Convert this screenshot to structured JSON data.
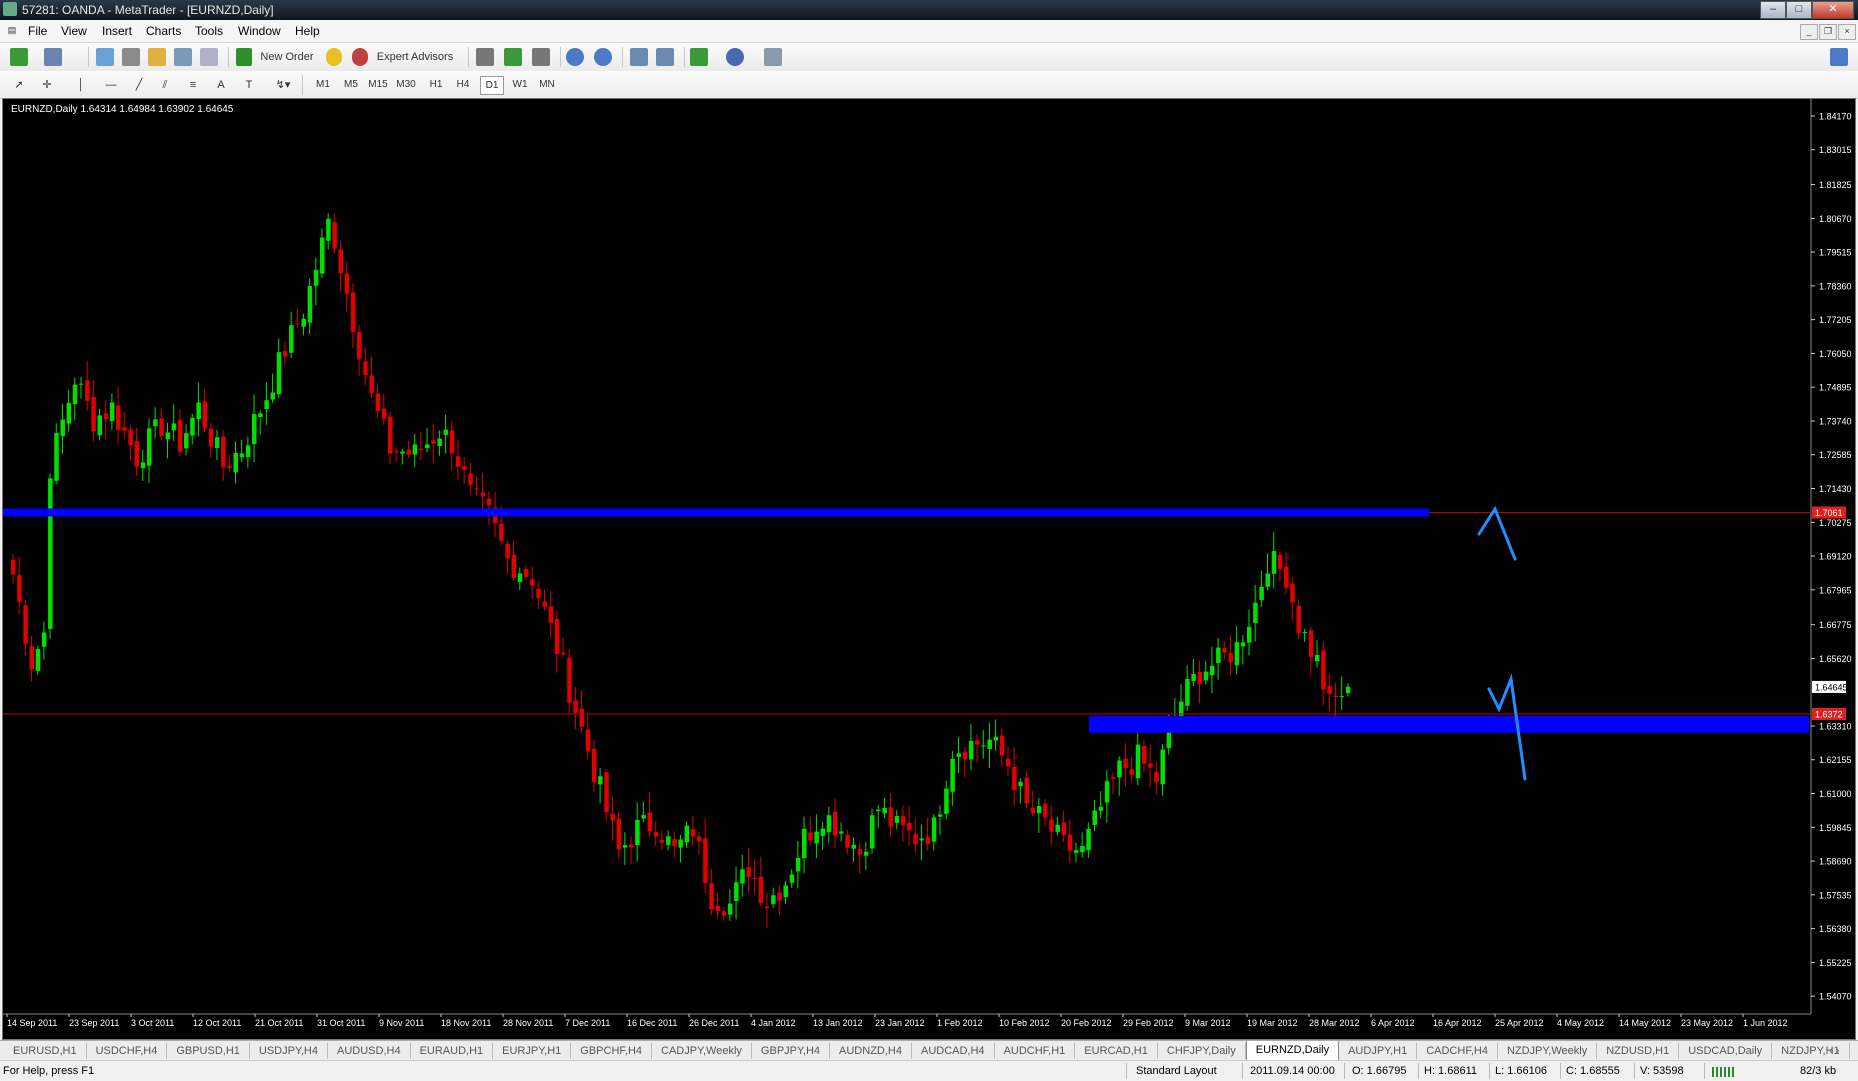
{
  "window": {
    "title": "57281: OANDA - MetaTrader - [EURNZD,Daily]"
  },
  "menu": {
    "items": [
      "File",
      "View",
      "Insert",
      "Charts",
      "Tools",
      "Window",
      "Help"
    ]
  },
  "toolbar": {
    "new_order_label": "New Order",
    "expert_advisors_label": "Expert Advisors"
  },
  "timeframes": {
    "items": [
      "M1",
      "M5",
      "M15",
      "M30",
      "H1",
      "H4",
      "D1",
      "W1",
      "MN"
    ],
    "active": "D1"
  },
  "chart": {
    "info": "EURNZD,Daily  1.64314 1.64984 1.63902 1.64645",
    "price_labels": [
      "1.84170",
      "1.83015",
      "1.81825",
      "1.80670",
      "1.79515",
      "1.78360",
      "1.77205",
      "1.76050",
      "1.74895",
      "1.73740",
      "1.72585",
      "1.71430",
      "1.70275",
      "1.69120",
      "1.67965",
      "1.66775",
      "1.65620",
      "1.64645",
      "1.63310",
      "1.62155",
      "1.61000",
      "1.59845",
      "1.58690",
      "1.57535",
      "1.56380",
      "1.55225",
      "1.54070"
    ],
    "line_tags": {
      "upper": "1.7061",
      "lower": "1.6372",
      "current": "1.64645"
    },
    "date_labels": [
      "14 Sep 2011",
      "23 Sep 2011",
      "3 Oct 2011",
      "12 Oct 2011",
      "21 Oct 2011",
      "31 Oct 2011",
      "9 Nov 2011",
      "18 Nov 2011",
      "28 Nov 2011",
      "7 Dec 2011",
      "16 Dec 2011",
      "26 Dec 2011",
      "4 Jan 2012",
      "13 Jan 2012",
      "23 Jan 2012",
      "1 Feb 2012",
      "10 Feb 2012",
      "20 Feb 2012",
      "29 Feb 2012",
      "9 Mar 2012",
      "19 Mar 2012",
      "28 Mar 2012",
      "6 Apr 2012",
      "16 Apr 2012",
      "25 Apr 2012",
      "4 May 2012",
      "14 May 2012",
      "23 May 2012",
      "1 Jun 2012"
    ],
    "colors": {
      "bull": "#00e000",
      "bear": "#e00000",
      "zone": "#0000ff",
      "line": "#c00000",
      "arrow": "#1e90ff"
    }
  },
  "chart_data": {
    "type": "candlestick",
    "symbol": "EURNZD",
    "timeframe": "Daily",
    "ylim": [
      1.5346,
      1.8475
    ],
    "zones": [
      {
        "price": 1.7061
      },
      {
        "price": 1.6335
      }
    ],
    "hlines": [
      {
        "price": 1.7061
      },
      {
        "price": 1.6372
      }
    ],
    "close_anchors": [
      [
        0,
        1.685
      ],
      [
        3,
        1.655
      ],
      [
        5,
        1.665
      ],
      [
        6,
        1.722
      ],
      [
        10,
        1.752
      ],
      [
        13,
        1.738
      ],
      [
        16,
        1.742
      ],
      [
        20,
        1.725
      ],
      [
        24,
        1.736
      ],
      [
        27,
        1.73
      ],
      [
        30,
        1.742
      ],
      [
        34,
        1.722
      ],
      [
        37,
        1.728
      ],
      [
        41,
        1.746
      ],
      [
        44,
        1.762
      ],
      [
        47,
        1.775
      ],
      [
        49,
        1.79
      ],
      [
        51,
        1.805
      ],
      [
        52,
        1.8
      ],
      [
        55,
        1.772
      ],
      [
        58,
        1.745
      ],
      [
        61,
        1.728
      ],
      [
        65,
        1.726
      ],
      [
        69,
        1.734
      ],
      [
        71,
        1.73
      ],
      [
        74,
        1.712
      ],
      [
        77,
        1.705
      ],
      [
        80,
        1.69
      ],
      [
        84,
        1.684
      ],
      [
        88,
        1.66
      ],
      [
        93,
        1.625
      ],
      [
        98,
        1.59
      ],
      [
        101,
        1.598
      ],
      [
        104,
        1.6
      ],
      [
        107,
        1.59
      ],
      [
        110,
        1.598
      ],
      [
        113,
        1.575
      ],
      [
        116,
        1.572
      ],
      [
        119,
        1.585
      ],
      [
        122,
        1.573
      ],
      [
        125,
        1.58
      ],
      [
        128,
        1.595
      ],
      [
        131,
        1.603
      ],
      [
        134,
        1.598
      ],
      [
        137,
        1.59
      ],
      [
        140,
        1.605
      ],
      [
        143,
        1.598
      ],
      [
        146,
        1.595
      ],
      [
        149,
        1.598
      ],
      [
        152,
        1.625
      ],
      [
        155,
        1.627
      ],
      [
        158,
        1.628
      ],
      [
        161,
        1.62
      ],
      [
        164,
        1.605
      ],
      [
        167,
        1.6
      ],
      [
        170,
        1.592
      ],
      [
        173,
        1.59
      ],
      [
        176,
        1.605
      ],
      [
        179,
        1.618
      ],
      [
        182,
        1.622
      ],
      [
        185,
        1.615
      ],
      [
        187,
        1.63
      ],
      [
        189,
        1.642
      ],
      [
        192,
        1.652
      ],
      [
        195,
        1.655
      ],
      [
        198,
        1.66
      ],
      [
        201,
        1.675
      ],
      [
        203,
        1.69
      ],
      [
        206,
        1.685
      ],
      [
        208,
        1.668
      ],
      [
        211,
        1.655
      ],
      [
        213,
        1.64
      ],
      [
        216,
        1.6465
      ]
    ]
  },
  "tabs": [
    "EURUSD,H1",
    "USDCHF,H4",
    "GBPUSD,H1",
    "USDJPY,H4",
    "AUDUSD,H4",
    "EURAUD,H1",
    "EURJPY,H1",
    "GBPCHF,H4",
    "CADJPY,Weekly",
    "GBPJPY,H4",
    "AUDNZD,H4",
    "AUDCAD,H4",
    "AUDCHF,H1",
    "EURCAD,H1",
    "CHFJPY,Daily",
    "EURNZD,Daily",
    "AUDJPY,H1",
    "CADCHF,H4",
    "NZDJPY,Weekly",
    "NZDUSD,H1",
    "USDCAD,Daily",
    "NZDJPY,H1"
  ],
  "active_tab": "EURNZD,Daily",
  "status": {
    "help": "For Help, press F1",
    "layout": "Standard Layout",
    "datetime": "2011.09.14 00:00",
    "open": "O: 1.66795",
    "high": "H: 1.68611",
    "low": "L: 1.66106",
    "close": "C: 1.68555",
    "volume": "V: 53598",
    "traffic": "82/3 kb"
  }
}
